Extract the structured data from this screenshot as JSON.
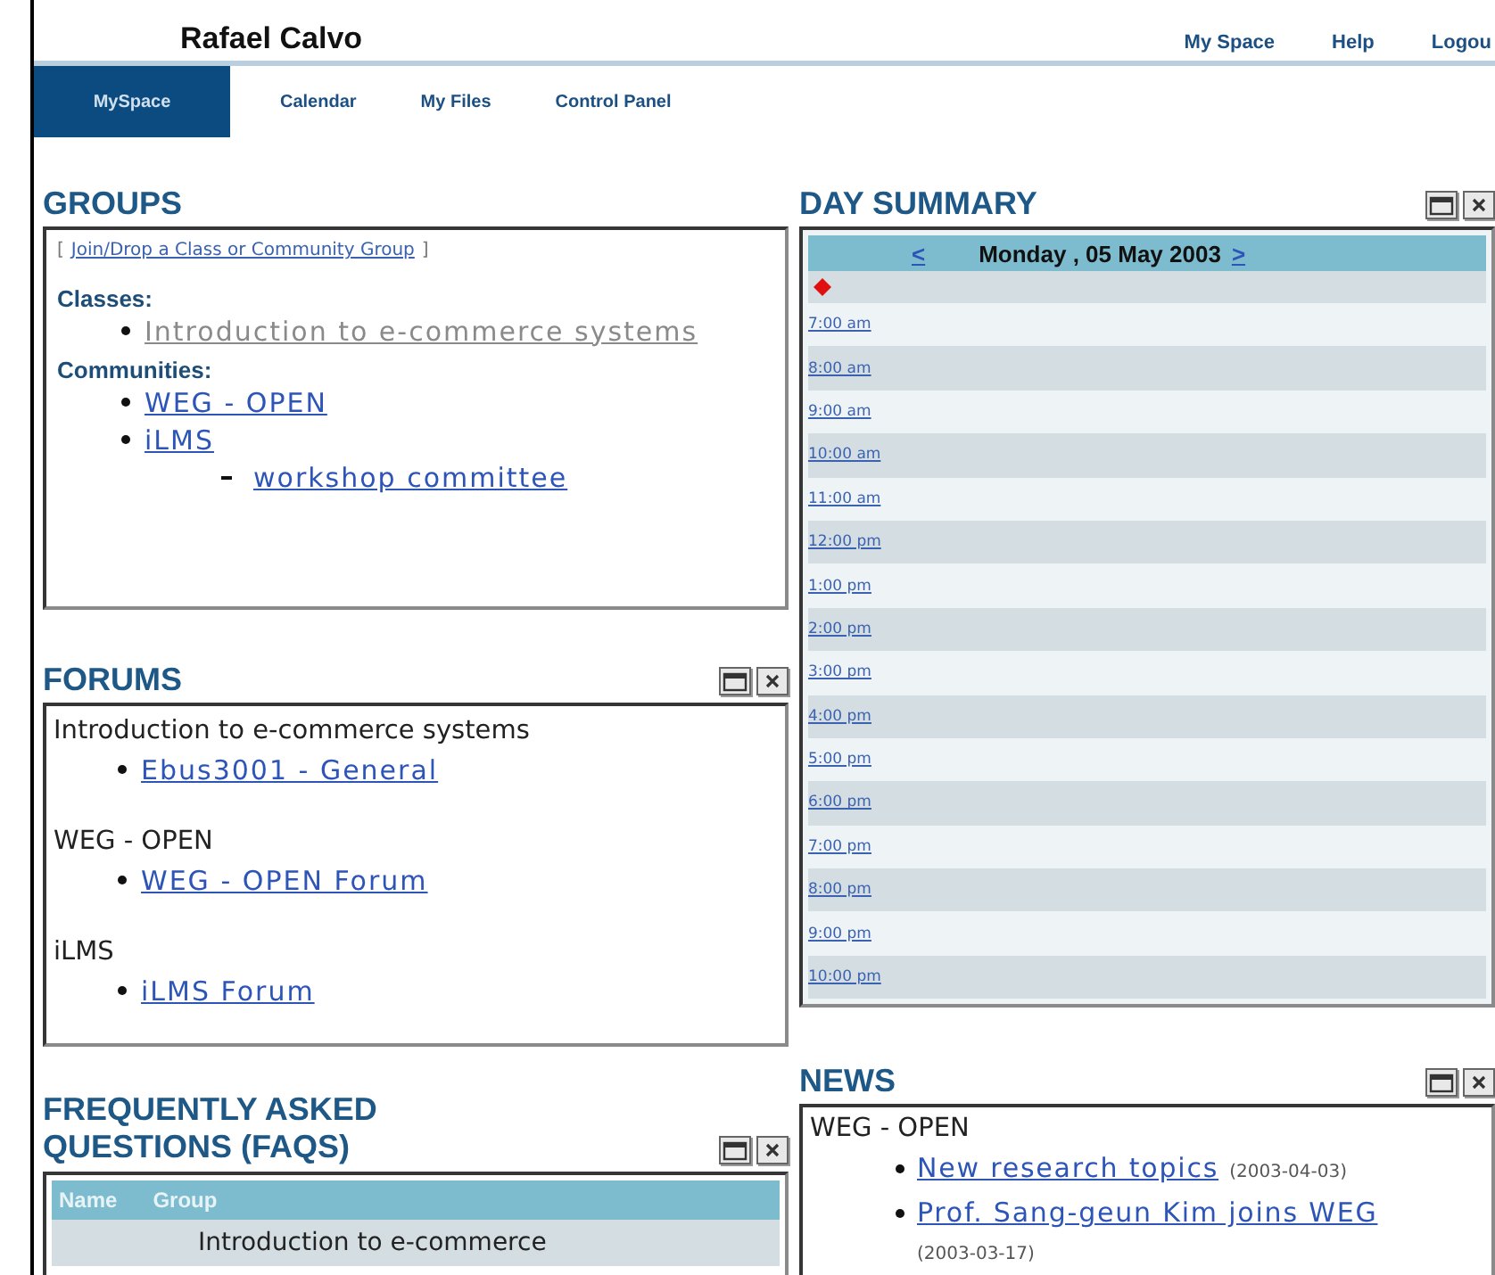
{
  "header": {
    "name": "Rafael Calvo",
    "links": [
      "My Space",
      "Help",
      "Logou"
    ]
  },
  "tabs": [
    {
      "label": "MySpace",
      "selected": true
    },
    {
      "label": "Calendar",
      "selected": false
    },
    {
      "label": "My Files",
      "selected": false
    },
    {
      "label": "Control Panel",
      "selected": false
    }
  ],
  "groups": {
    "title": "GROUPS",
    "join_link": "Join/Drop a Class or Community Group",
    "bracket_open": "[",
    "bracket_close": "]",
    "classes_label": "Classes:",
    "classes": [
      {
        "label": "Introduction to e-commerce systems",
        "disabled": true
      }
    ],
    "communities_label": "Communities:",
    "communities": [
      {
        "label": "WEG - OPEN",
        "disabled": false
      },
      {
        "label": "iLMS",
        "disabled": false,
        "children": [
          {
            "label": "workshop committee"
          }
        ]
      }
    ]
  },
  "forums": {
    "title": "FORUMS",
    "window_controls": true,
    "groups": [
      {
        "name": "Introduction to e-commerce systems",
        "forums": [
          "Ebus3001 - General"
        ]
      },
      {
        "name": "WEG - OPEN",
        "forums": [
          "WEG - OPEN Forum"
        ]
      },
      {
        "name": "iLMS",
        "forums": [
          "iLMS Forum"
        ]
      }
    ]
  },
  "faqs": {
    "title": "FREQUENTLY ASKED QUESTIONS (FAQS)",
    "window_controls": true,
    "columns": [
      "Name",
      "Group"
    ],
    "rows": [
      {
        "group": "Introduction to e-commerce"
      }
    ]
  },
  "day_summary": {
    "title": "DAY SUMMARY",
    "window_controls": true,
    "prev": "<",
    "date": "Monday , 05 May 2003",
    "next": ">",
    "times": [
      "7:00 am",
      "8:00 am",
      "9:00 am",
      "10:00 am",
      "11:00 am",
      "12:00 pm",
      "1:00 pm",
      "2:00 pm",
      "3:00 pm",
      "4:00 pm",
      "5:00 pm",
      "6:00 pm",
      "7:00 pm",
      "8:00 pm",
      "9:00 pm",
      "10:00 pm"
    ]
  },
  "news": {
    "title": "NEWS",
    "window_controls": true,
    "groups": [
      {
        "name": "WEG - OPEN",
        "items": [
          {
            "title": "New research topics",
            "date": "(2003-04-03)"
          },
          {
            "title": "Prof. Sang-geun Kim joins WEG",
            "date": "(2003-03-17)"
          }
        ]
      }
    ]
  }
}
